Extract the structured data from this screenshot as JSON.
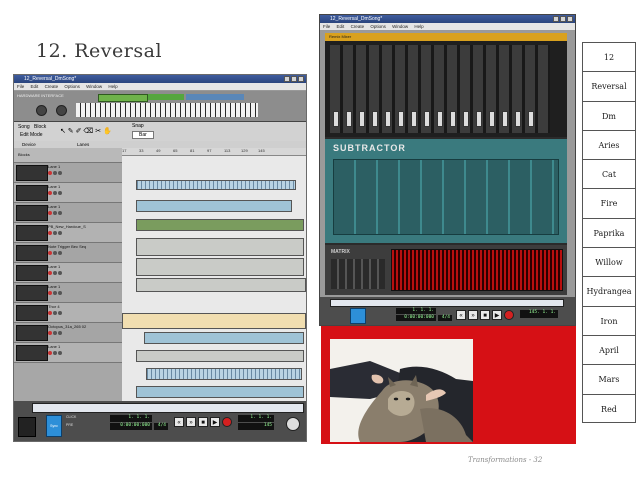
{
  "slide": {
    "title": "12. Reversal",
    "footer": "Transformations - 32"
  },
  "left_window": {
    "title": "12_Reversal_DmSong*",
    "menu": [
      "File",
      "Edit",
      "Create",
      "Options",
      "Window",
      "Help"
    ],
    "hardware_label": "HARDWARE INTERFACE",
    "toolbar": {
      "song_label": "Song",
      "block_label": "Block",
      "edit_mode_label": "Edit Mode",
      "snap_label": "Snap",
      "snap_value": "Bar",
      "device_label": "Device",
      "lanes_label": "Lanes"
    },
    "ruler_ticks": [
      "17",
      "33",
      "49",
      "65",
      "81",
      "97",
      "113",
      "129",
      "145"
    ],
    "blocks_label": "Blocks",
    "tracks": [
      {
        "name": "SubTractor 1",
        "lane": "Lane 1"
      },
      {
        "name": "SubTractor 2",
        "lane": "Lane 1"
      },
      {
        "name": "Lane 1",
        "lane": "Lane 1"
      },
      {
        "name": "Kong",
        "lane": "PB_New_Hardcue_S"
      },
      {
        "name": "Thor 2",
        "lane": "Note Trigger Bec Seq"
      },
      {
        "name": "Volca VT",
        "lane": "Lane 1"
      },
      {
        "name": "Thor 3",
        "lane": "Lane 1"
      },
      {
        "name": "Vir. Duo Rex 1",
        "lane": "Thor 4"
      },
      {
        "name": "Volca VT",
        "lane": "Octopus_31a_265 02"
      },
      {
        "name": "",
        "lane": "Lane 1"
      }
    ],
    "transport": {
      "position": "1. 1. 1.",
      "time": "0:00:00:000",
      "signature": "4/4",
      "tempo": "145",
      "click_label": "CLICK",
      "pre_label": "PRE",
      "sync_label": "Sync",
      "loop_start": "1. 1. 1.",
      "loop_end": "1. 1. 1."
    }
  },
  "right_window": {
    "title": "12_Reversal_DmSong*",
    "menu": [
      "File",
      "Edit",
      "Create",
      "Options",
      "Window",
      "Help"
    ],
    "mixer_label": "Remix Mixer",
    "drum_label": "SUBTRACTOR",
    "matrix_label": "MATRIX",
    "transport": {
      "position": "1. 1. 1.",
      "time": "0:00:00:000",
      "signature": "4/4",
      "tempo": "145. 1. 1."
    }
  },
  "photo": {
    "icon": "cat-photo"
  },
  "sidebar_list": {
    "items": [
      "12",
      "Reversal",
      "Dm",
      "Aries",
      "Cat",
      "Fire",
      "Paprika",
      "Willow",
      "Hydrangea",
      "Iron",
      "April",
      "Mars",
      "Red"
    ]
  },
  "colors": {
    "red_box": "#d61015",
    "mixer_accent": "#d9a11e",
    "drum_teal": "#3a7a7e",
    "matrix_red": "#b80f0f"
  }
}
